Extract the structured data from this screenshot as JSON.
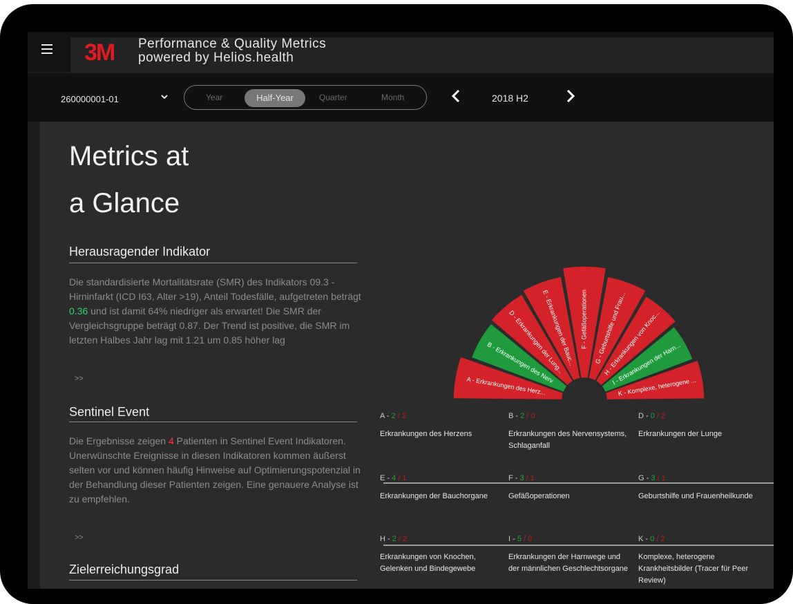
{
  "app": {
    "logo": "3M",
    "title_line1": "Performance & Quality Metrics",
    "title_line2": "powered by Helios.health"
  },
  "toolbar": {
    "facility": "260000001-01",
    "periods": [
      "Year",
      "Half-Year",
      "Quarter",
      "Month"
    ],
    "selected_period": "Half-Year",
    "current_period": "2018 H2"
  },
  "main": {
    "heading_line1": "Metrics at",
    "heading_line2": "a Glance",
    "outstanding": {
      "title": "Herausragender Indikator",
      "text_before": "Die standardisierte Mortalitätsrate (SMR) des Indikators 09.3 - Hirninfarkt (ICD I63, Alter >19), Anteil Todesfälle, aufgetreten beträgt ",
      "value": "0.36",
      "text_after": " und ist damit 64% niedriger als erwartet! Die SMR der Vergleichsgruppe beträgt 0.87. Der Trend ist positive, die SMR im letzten Halbes Jahr lag mit 1.21 um 0.85 höher lag",
      "more": ">>"
    },
    "sentinel": {
      "title": "Sentinel Event",
      "text_before": "Die Ergebnisse zeigen ",
      "count": "4",
      "text_after": " Patienten in Sentinel Event Indikatoren. Unerwünschte Ereignisse in diesen Indikatoren kommen äußerst selten vor und können häufig Hinweise auf Optimierungspotenzial in der Behandlung dieser Patienten zeigen. Eine genauere Analyse ist zu empfehlen.",
      "more": ">>"
    },
    "target": {
      "title": "Zielerreichungsgrad"
    }
  },
  "fan": {
    "colors": {
      "red": "#d3222a",
      "green": "#1f9b3e"
    },
    "segments": [
      {
        "label": "A - Erkrankungen des Herz...",
        "status": "red"
      },
      {
        "label": "B - Erkrankungen des Nerv",
        "status": "green"
      },
      {
        "label": "D - Erkrankungen der Lung...",
        "status": "red"
      },
      {
        "label": "E - Erkrankungen der Bauc...",
        "status": "red"
      },
      {
        "label": "F - Gefäßoperationen",
        "status": "red"
      },
      {
        "label": "G - Geburtshilfe und Frau...",
        "status": "red"
      },
      {
        "label": "H - Erkrankungen von Knoc...",
        "status": "red"
      },
      {
        "label": "I - Erkrankungen der Harn...",
        "status": "green"
      },
      {
        "label": "K - Komplexe, heterogene ...",
        "status": "red"
      }
    ]
  },
  "categories": [
    {
      "code": "A",
      "green": "2",
      "red": "2",
      "name": "Erkrankungen des Herzens"
    },
    {
      "code": "B",
      "green": "2",
      "red": "0",
      "name": "Erkrankungen des Nervensystems, Schlaganfall"
    },
    {
      "code": "D",
      "green": "0",
      "red": "2",
      "name": "Erkrankungen der Lunge"
    },
    {
      "code": "E",
      "green": "4",
      "red": "1",
      "name": "Erkrankungen der Bauchorgane"
    },
    {
      "code": "F",
      "green": "3",
      "red": "1",
      "name": "Gefäßoperationen"
    },
    {
      "code": "G",
      "green": "3",
      "red": "1",
      "name": "Geburtshilfe und Frauenheilkunde"
    },
    {
      "code": "H",
      "green": "2",
      "red": "2",
      "name": "Erkrankungen von Knochen, Gelenken und Bindegewebe"
    },
    {
      "code": "I",
      "green": "5",
      "red": "0",
      "name": "Erkrankungen der Harnwege und der männlichen Geschlechtsorgane"
    },
    {
      "code": "K",
      "green": "0",
      "red": "2",
      "name": "Komplexe, heterogene Krankheitsbilder (Tracer für Peer Review)"
    }
  ]
}
